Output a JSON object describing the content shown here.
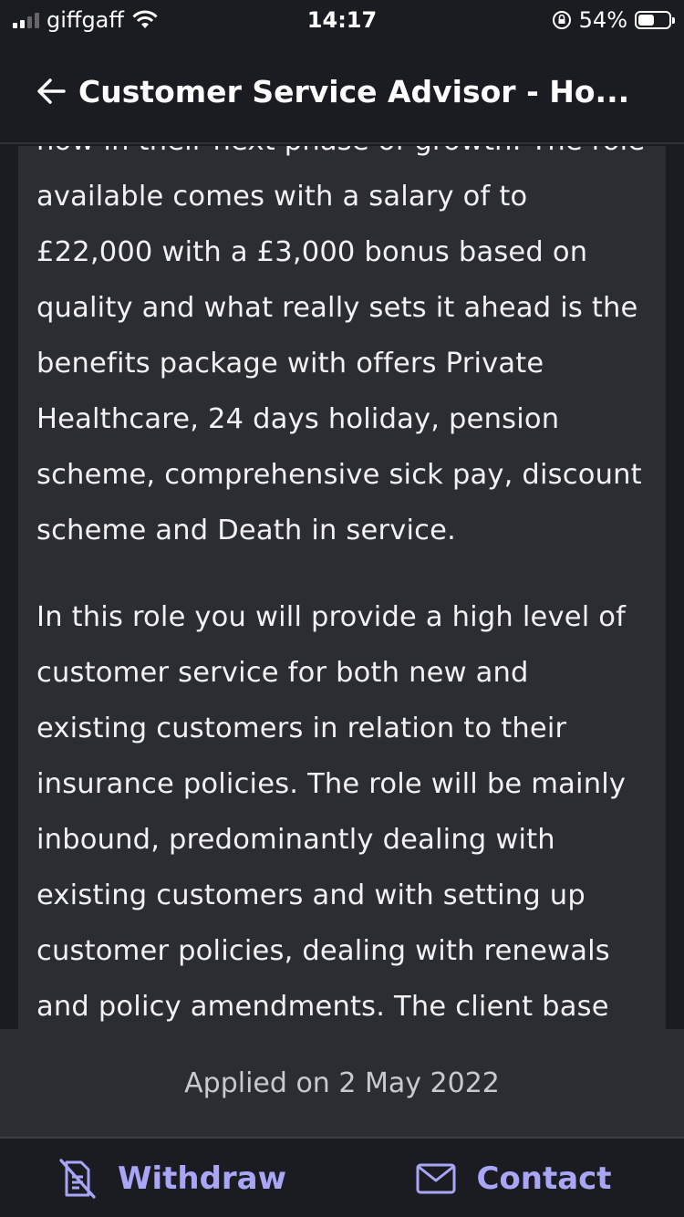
{
  "status_bar": {
    "carrier": "giffgaff",
    "time": "14:17",
    "battery_percent": "54%",
    "battery_level": 0.54
  },
  "header": {
    "title": "Customer Service Advisor - Ho..."
  },
  "content": {
    "paragraphs": [
      "now in their next phase of growth. The role available comes with a salary of to £22,000 with a £3,000 bonus based on quality and what really sets it ahead is the benefits package with offers Private Healthcare, 24 days holiday, pension scheme, comprehensive sick pay, discount scheme and Death in service.",
      "In this role you will provide a high level of customer service for both new and existing customers in relation to their insurance policies. The role will be mainly inbound, predominantly dealing with existing customers and with setting up customer policies, dealing with renewals and policy amendments. The client base"
    ]
  },
  "applied": {
    "text": "Applied on 2 May 2022"
  },
  "actions": {
    "withdraw_label": "Withdraw",
    "withdraw_icon": "document-off-icon",
    "contact_label": "Contact",
    "contact_icon": "mail-icon"
  },
  "colors": {
    "accent": "#a9a6f7",
    "background": "#1a1c21",
    "card": "#2b2d33"
  }
}
